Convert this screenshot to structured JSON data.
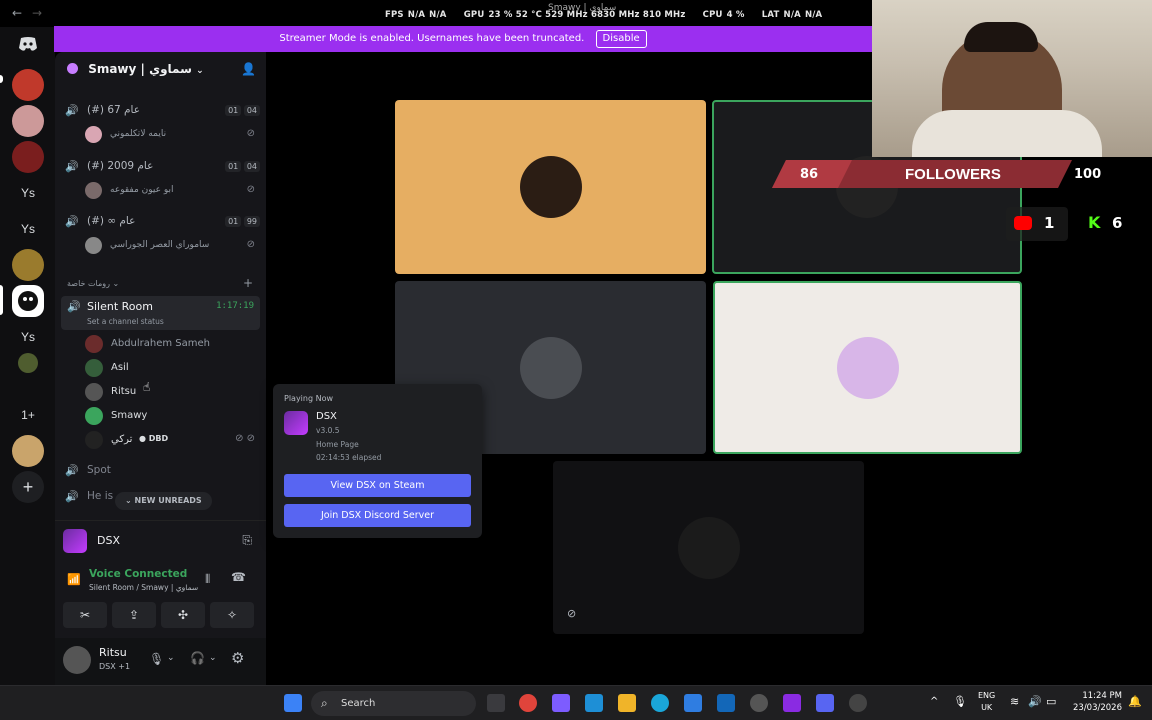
{
  "hud": {
    "fps_label": "FPS",
    "fps_val1": "N/A",
    "fps_val2": "N/A",
    "gpu_label": "GPU",
    "gpu_val": "23 % 52 °C 529 MHz 6830 MHz 810 MHz",
    "cpu_label": "CPU",
    "cpu_val": "4 %",
    "lat_label": "LAT",
    "lat_val1": "N/A",
    "lat_val2": "N/A",
    "window_title": "Smawy | سماوي"
  },
  "rail": {
    "items": [
      {
        "label": "",
        "color": "#5865f2",
        "icon": "discord-home-icon"
      },
      {
        "label": "",
        "color": "#c0392b"
      },
      {
        "label": "",
        "color": "#b77"
      },
      {
        "label": "",
        "color": "#7a1e1e"
      },
      {
        "label": "Ys"
      },
      {
        "label": "Ys"
      },
      {
        "label": "",
        "color": "#6b8e23"
      },
      {
        "label": "",
        "color": "#2e8b57"
      },
      {
        "label": "Ys"
      },
      {
        "label": "",
        "color": "#556b2f"
      },
      {
        "label": "1+"
      },
      {
        "label": "",
        "color": "#d4a373"
      }
    ],
    "add_label": "+"
  },
  "server": {
    "name": "Smawy | سماوي"
  },
  "channels": [
    {
      "name": "(#) 67 عام",
      "a": "01",
      "b": "04",
      "member": "نايمه لاتكلموني"
    },
    {
      "name": "(#) 2009 عام",
      "a": "01",
      "b": "04",
      "member": "ابو عيون مفقوعه"
    },
    {
      "name": "(#) ∞ عام",
      "a": "01",
      "b": "99",
      "member": "ساموراي العصر الجوراسي"
    }
  ],
  "category": "رومات خاصة",
  "category_add": "+",
  "silent_room": {
    "name": "Silent Room",
    "timer": "1:17:19",
    "status": "Set a channel status",
    "members": [
      {
        "name": "Abdulrahem Sameh"
      },
      {
        "name": "Asil"
      },
      {
        "name": "Ritsu"
      },
      {
        "name": "Smawy"
      },
      {
        "name": "تركي",
        "extra": "DBD"
      }
    ]
  },
  "spot": "Spot",
  "he_is": "He is",
  "new_unreads": "NEW UNREADS",
  "activity": {
    "name": "DSX"
  },
  "voice": {
    "status": "Voice Connected",
    "where": "Silent Room / Smawy | سماوي"
  },
  "user": {
    "name": "Ritsu",
    "sub": "DSX +1"
  },
  "streamer": {
    "text": "Streamer Mode is enabled. Usernames have been truncated.",
    "button": "Disable"
  },
  "popup": {
    "label": "Playing Now",
    "game": "DSX",
    "version": "v3.0.5",
    "page": "Home Page",
    "elapsed": "02:14:53 elapsed",
    "btn1": "View DSX on Steam",
    "btn2": "Join DSX Discord Server"
  },
  "overlay": {
    "followers_left": "86",
    "followers_label": "FOLLOWERS",
    "followers_right": "100",
    "yt_count": "1",
    "kick_count": "6"
  },
  "taskbar": {
    "search": "Search",
    "lang1": "ENG",
    "lang2": "UK",
    "time": "11:24 PM",
    "date": "23/03/2026"
  },
  "colors": {
    "accent": "#5865f2",
    "streamer": "#9b2ff0",
    "green": "#3ba55d",
    "tile_orange": "#e6ae62"
  }
}
